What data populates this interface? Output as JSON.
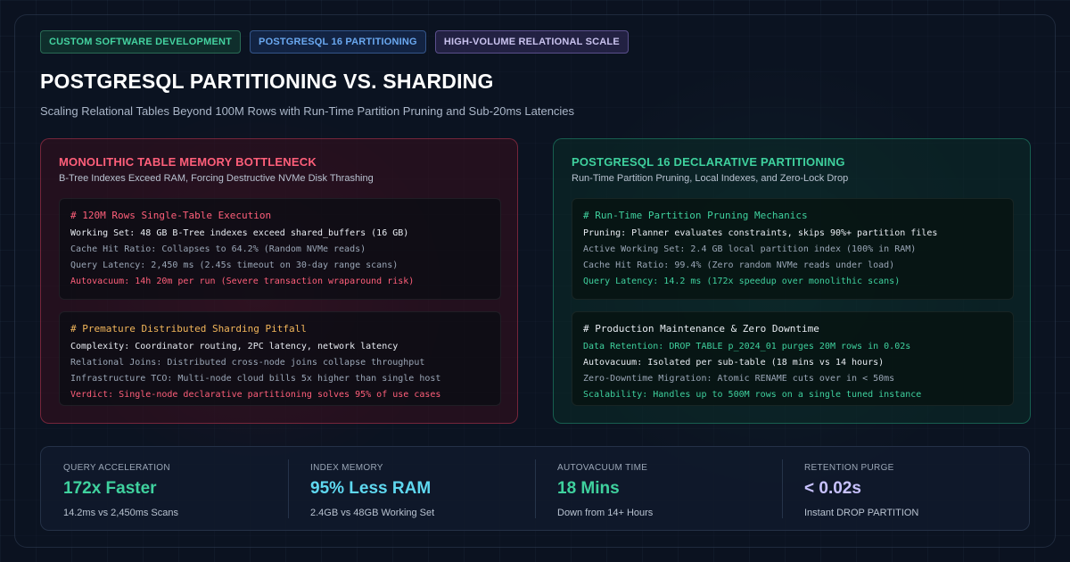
{
  "tags": [
    "CUSTOM SOFTWARE DEVELOPMENT",
    "POSTGRESQL 16 PARTITIONING",
    "HIGH-VOLUME RELATIONAL SCALE"
  ],
  "title": "POSTGRESQL PARTITIONING VS. SHARDING",
  "subtitle": "Scaling Relational Tables Beyond 100M Rows with Run-Time Partition Pruning and Sub-20ms Latencies",
  "colors": {
    "left_accent": "#ff5f7a",
    "right_accent": "#3fd19e",
    "pitfall_accent": "#f2b65a",
    "background": "#0b1220"
  },
  "left_panel": {
    "title": "MONOLITHIC TABLE MEMORY BOTTLENECK",
    "subtitle": "B-Tree Indexes Exceed RAM, Forcing Destructive NVMe Disk Thrashing",
    "block_a": {
      "heading": "# 120M Rows Single-Table Execution",
      "lines": [
        "Working Set: 48 GB B-Tree indexes exceed shared_buffers (16 GB)",
        "Cache Hit Ratio: Collapses to 64.2% (Random NVMe reads)",
        "Query Latency: 2,450 ms (2.45s timeout on 30-day range scans)",
        "Autovacuum: 14h 20m per run (Severe transaction wraparound risk)"
      ]
    },
    "block_b": {
      "heading": "# Premature Distributed Sharding Pitfall",
      "lines": [
        "Complexity: Coordinator routing, 2PC latency, network latency",
        "Relational Joins: Distributed cross-node joins collapse throughput",
        "Infrastructure TCO: Multi-node cloud bills 5x higher than single host",
        "Verdict: Single-node declarative partitioning solves 95% of use cases"
      ]
    }
  },
  "right_panel": {
    "title": "POSTGRESQL 16 DECLARATIVE PARTITIONING",
    "subtitle": "Run-Time Partition Pruning, Local Indexes, and Zero-Lock Drop",
    "block_a": {
      "heading": "# Run-Time Partition Pruning Mechanics",
      "lines": [
        "Pruning: Planner evaluates constraints, skips 90%+ partition files",
        "Active Working Set: 2.4 GB local partition index (100% in RAM)",
        "Cache Hit Ratio: 99.4% (Zero random NVMe reads under load)",
        "Query Latency: 14.2 ms (172x speedup over monolithic scans)"
      ]
    },
    "block_b": {
      "heading": "# Production Maintenance & Zero Downtime",
      "lines": [
        "Data Retention: DROP TABLE p_2024_01 purges 20M rows in 0.02s",
        "Autovacuum: Isolated per sub-table (18 mins vs 14 hours)",
        "Zero-Downtime Migration: Atomic RENAME cuts over in < 50ms",
        "Scalability: Handles up to 500M rows on a single tuned instance"
      ]
    }
  },
  "stats": [
    {
      "label": "QUERY ACCELERATION",
      "value": "172x Faster",
      "note": "14.2ms vs 2,450ms Scans"
    },
    {
      "label": "INDEX MEMORY",
      "value": "95% Less RAM",
      "note": "2.4GB vs 48GB Working Set"
    },
    {
      "label": "AUTOVACUUM TIME",
      "value": "18 Mins",
      "note": "Down from 14+ Hours"
    },
    {
      "label": "RETENTION PURGE",
      "value": "< 0.02s",
      "note": "Instant DROP PARTITION"
    }
  ]
}
